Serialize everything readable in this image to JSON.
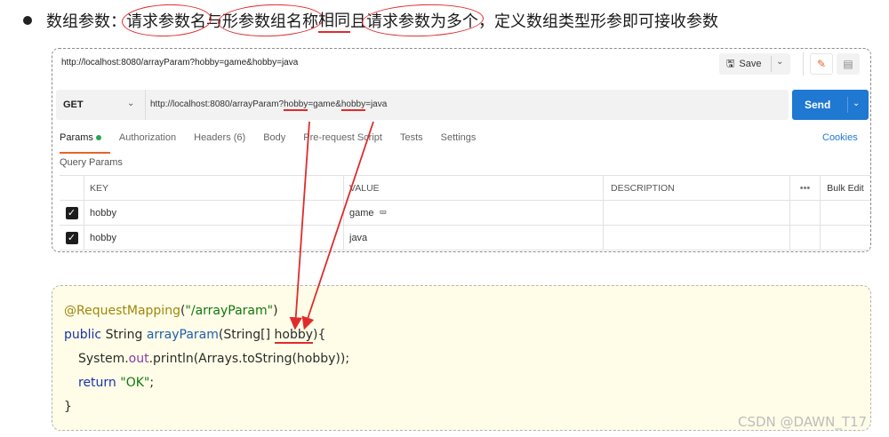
{
  "heading": {
    "part1": "数组参数：",
    "part2": "请求参数名",
    "part3": "与",
    "part4": "形参数组名称",
    "part5": "相同",
    "part6": "且",
    "part7": "请求参数为多个",
    "part8": "，定义数组类型形参即可接收参数"
  },
  "postman": {
    "tab_url": "http://localhost:8080/arrayParam?hobby=game&hobby=java",
    "save_label": "Save",
    "method": "GET",
    "url_prefix": "http://localhost:8080/arrayParam?",
    "url_param1": "hobby",
    "url_mid": "=game&",
    "url_param2": "hobby",
    "url_suffix": "=java",
    "send_label": "Send",
    "tabs": [
      {
        "label": "Params"
      },
      {
        "label": "Authorization"
      },
      {
        "label": "Headers",
        "count": "(6)"
      },
      {
        "label": "Body"
      },
      {
        "label": "Pre-request Script"
      },
      {
        "label": "Tests"
      },
      {
        "label": "Settings"
      }
    ],
    "cookies_label": "Cookies",
    "query_params_label": "Query Params",
    "table": {
      "headers": {
        "key": "KEY",
        "value": "VALUE",
        "description": "DESCRIPTION",
        "more": "•••",
        "bulk": "Bulk Edit"
      },
      "rows": [
        {
          "key": "hobby",
          "value": "game",
          "description": ""
        },
        {
          "key": "hobby",
          "value": "java",
          "description": ""
        }
      ]
    }
  },
  "code": {
    "l1_anno": "@RequestMapping",
    "l1_open": "(",
    "l1_str": "\"/arrayParam\"",
    "l1_close": ")",
    "l2_kw": "public",
    "l2_type": " String ",
    "l2_fn": "arrayParam",
    "l2_open": "(String[] ",
    "l2_param": "hobby",
    "l2_close": "){",
    "l3_a": "System.",
    "l3_fld": "out",
    "l3_b": ".println(Arrays.toString(hobby));",
    "l4_kw": "return",
    "l4_str": " \"OK\"",
    "l4_end": ";",
    "l5": "}"
  },
  "watermark": "CSDN @DAWN_T17",
  "colors": {
    "annotation": "#e02b2b",
    "send_blue": "#1f78d1",
    "active_tab": "#e8622c",
    "code_bg": "#fffde7"
  },
  "icons": {
    "save": "save-icon",
    "edit": "pencil-icon",
    "doc": "document-icon",
    "check": "checkbox-checked-icon",
    "cursor": "mouse-cursor-icon"
  }
}
